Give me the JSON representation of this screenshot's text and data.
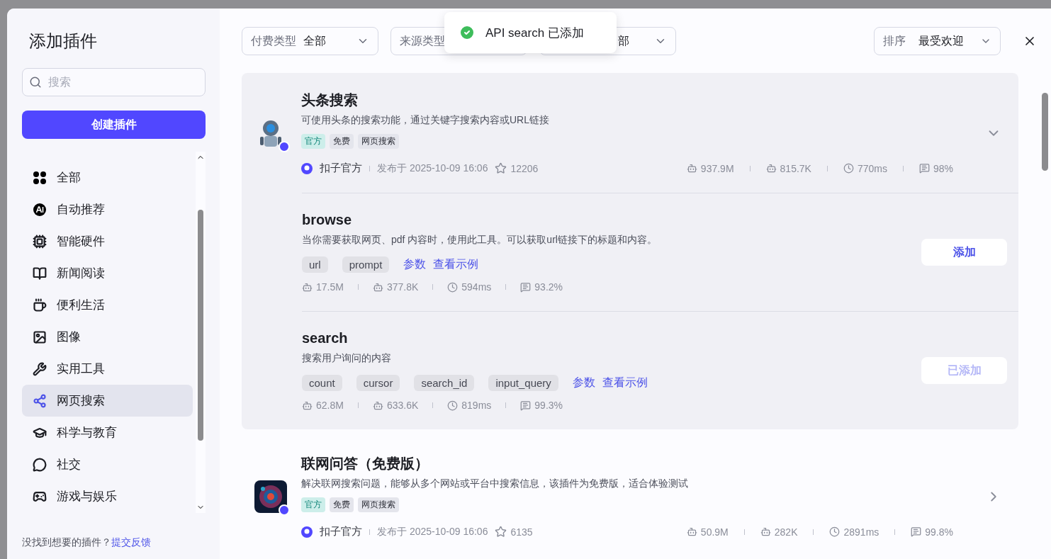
{
  "sidebar": {
    "title": "添加插件",
    "search": {
      "placeholder": "搜索"
    },
    "create_button": "创建插件",
    "categories": [
      {
        "label": "全部",
        "selected": false
      },
      {
        "label": "自动推荐",
        "selected": false
      },
      {
        "label": "智能硬件",
        "selected": false
      },
      {
        "label": "新闻阅读",
        "selected": false
      },
      {
        "label": "便利生活",
        "selected": false
      },
      {
        "label": "图像",
        "selected": false
      },
      {
        "label": "实用工具",
        "selected": false
      },
      {
        "label": "网页搜索",
        "selected": true
      },
      {
        "label": "科学与教育",
        "selected": false
      },
      {
        "label": "社交",
        "selected": false
      },
      {
        "label": "游戏与娱乐",
        "selected": false
      }
    ],
    "footer": {
      "text": "没找到想要的插件？",
      "link": "提交反馈"
    }
  },
  "filters": [
    {
      "label": "付费类型",
      "value": "全部"
    },
    {
      "label": "来源类型"
    },
    {
      "value": "部"
    }
  ],
  "sort": {
    "label": "排序",
    "value": "最受欢迎"
  },
  "toast": {
    "text": "API search 已添加"
  },
  "plugins": [
    {
      "name": "头条搜索",
      "description": "可使用头条的搜索功能，通过关键字搜索内容或URL链接",
      "expanded": true,
      "tags": [
        {
          "label": "官方",
          "kind": "official"
        },
        {
          "label": "免费",
          "kind": "plain"
        },
        {
          "label": "网页搜索",
          "kind": "plain"
        }
      ],
      "author": "扣子官方",
      "published": "发布于 2025-10-09 16:06",
      "stars": "12206",
      "stats": [
        "937.9M",
        "815.7K",
        "770ms",
        "98%"
      ],
      "tools": [
        {
          "name": "browse",
          "description": "当你需要获取网页、pdf 内容时，使用此工具。可以获取url链接下的标题和内容。",
          "params": [
            "url",
            "prompt"
          ],
          "links": [
            "参数",
            "查看示例"
          ],
          "stats": [
            "17.5M",
            "377.8K",
            "594ms",
            "93.2%"
          ],
          "added": false,
          "button": "添加"
        },
        {
          "name": "search",
          "description": "搜索用户询问的内容",
          "params": [
            "count",
            "cursor",
            "search_id",
            "input_query"
          ],
          "links": [
            "参数",
            "查看示例"
          ],
          "stats": [
            "62.8M",
            "633.6K",
            "819ms",
            "99.3%"
          ],
          "added": true,
          "button": "已添加"
        }
      ]
    },
    {
      "name": "联网问答（免费版）",
      "description": "解决联网搜索问题，能够从多个网站或平台中搜索信息，该插件为免费版，适合体验测试",
      "expanded": false,
      "tags": [
        {
          "label": "官方",
          "kind": "official"
        },
        {
          "label": "免费",
          "kind": "plain"
        },
        {
          "label": "网页搜索",
          "kind": "plain"
        }
      ],
      "author": "扣子官方",
      "published": "发布于 2025-10-09 16:06",
      "stars": "6135",
      "stats": [
        "50.9M",
        "282K",
        "2891ms",
        "99.8%"
      ]
    }
  ]
}
